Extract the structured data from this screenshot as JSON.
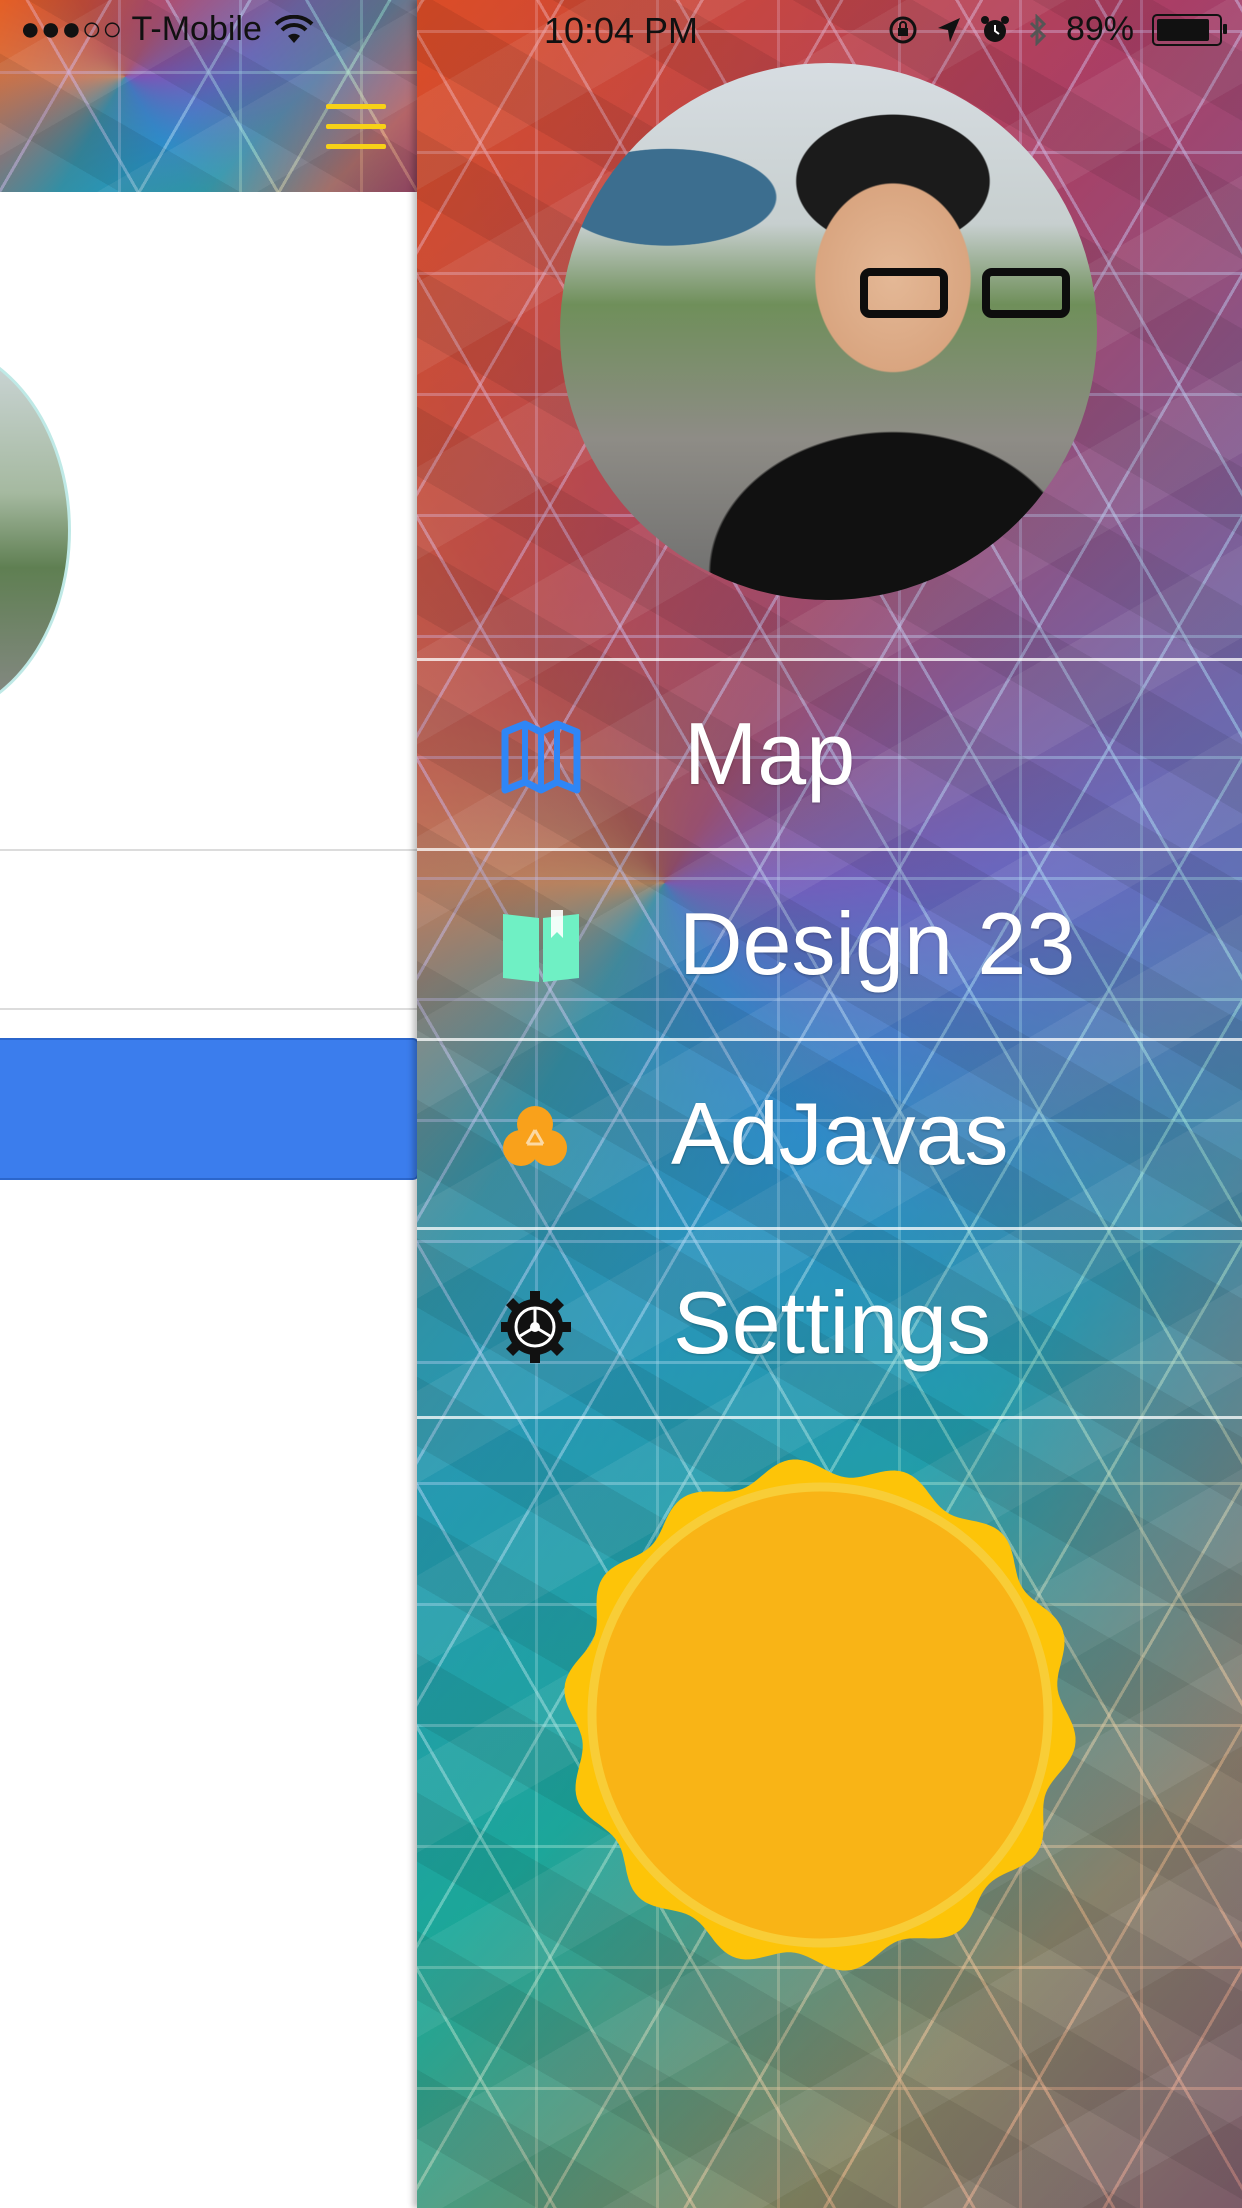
{
  "status_bar": {
    "carrier": "●●●○○ T-Mobile",
    "time": "10:04 PM",
    "battery_percent": "89%",
    "battery_level": 0.89,
    "icons": [
      "wifi-icon",
      "orientation-lock-icon",
      "location-arrow-icon",
      "alarm-icon",
      "bluetooth-icon",
      "battery-icon"
    ]
  },
  "left_panel": {
    "menu_icon": "hamburger-icon",
    "accent_color": "#f7d117",
    "button_color": "#3b7ded"
  },
  "drawer": {
    "menu": [
      {
        "label": "Map",
        "icon": "map-icon",
        "icon_color": "#2f86f6"
      },
      {
        "label": "Design 23",
        "icon": "book-icon",
        "icon_color": "#6ff0c4"
      },
      {
        "label": "AdJavas",
        "icon": "trefoil-icon",
        "icon_color": "#f9a11b"
      },
      {
        "label": "Settings",
        "icon": "gear-icon",
        "icon_color": "#111111"
      }
    ],
    "badge_color": "#fbb516"
  }
}
